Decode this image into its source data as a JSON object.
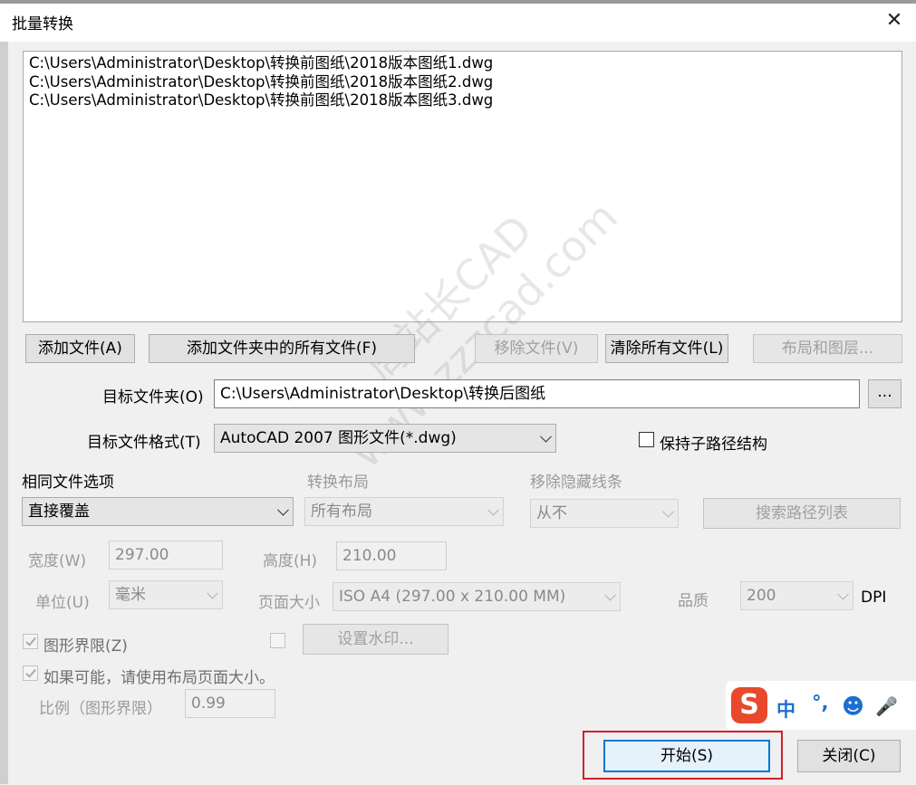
{
  "dialog": {
    "title": "批量转换",
    "close_glyph": "✕"
  },
  "file_list": {
    "items": [
      "C:\\Users\\Administrator\\Desktop\\转换前图纸\\2018版本图纸1.dwg",
      "C:\\Users\\Administrator\\Desktop\\转换前图纸\\2018版本图纸2.dwg",
      "C:\\Users\\Administrator\\Desktop\\转换前图纸\\2018版本图纸3.dwg"
    ]
  },
  "buttons": {
    "add_file": "添加文件(A)",
    "add_folder_files": "添加文件夹中的所有文件(F)",
    "remove_file": "移除文件(V)",
    "clear_all": "清除所有文件(L)",
    "layouts_layers": "布局和图层...",
    "browse": "...",
    "search_path_list": "搜索路径列表",
    "set_watermark": "设置水印...",
    "start": "开始(S)",
    "close": "关闭(C)"
  },
  "target_folder": {
    "label": "目标文件夹(O)",
    "value": "C:\\Users\\Administrator\\Desktop\\转换后图纸"
  },
  "target_format": {
    "label": "目标文件格式(T)",
    "value": "AutoCAD 2007 图形文件(*.dwg)"
  },
  "keep_subpath": {
    "label": "保持子路径结构",
    "checked": false
  },
  "same_file_option": {
    "label": "相同文件选项",
    "value": "直接覆盖"
  },
  "convert_layout": {
    "label": "转换布局",
    "value": "所有布局"
  },
  "remove_hidden_lines": {
    "label": "移除隐藏线条",
    "value": "从不"
  },
  "width": {
    "label": "宽度(W)",
    "value": "297.00"
  },
  "height": {
    "label": "高度(H)",
    "value": "210.00"
  },
  "unit": {
    "label": "单位(U)",
    "value": "毫米"
  },
  "page_size": {
    "label": "页面大小",
    "value": "ISO A4 (297.00 x 210.00 MM)"
  },
  "quality": {
    "label": "品质",
    "value": "200",
    "unit": "DPI"
  },
  "drawing_limits": {
    "label": "图形界限(Z)",
    "checked": true
  },
  "watermark_enabled": {
    "checked": false
  },
  "use_layout_page_size": {
    "label": "如果可能，请使用布局页面大小。",
    "checked": true
  },
  "scale": {
    "label": "比例（图形界限）",
    "value": "0.99"
  },
  "ime_toolbar": {
    "logo": "S",
    "mode": "中",
    "punct": "°,",
    "emoji": "☻",
    "voice": "🎤"
  },
  "watermark_text": {
    "line1": "周站长CAD",
    "line2": "www.zzzcad.com"
  },
  "colors": {
    "highlight": "#d0202a",
    "ime_logo": "#e8492c",
    "ime_blue": "#1c6fd0"
  }
}
